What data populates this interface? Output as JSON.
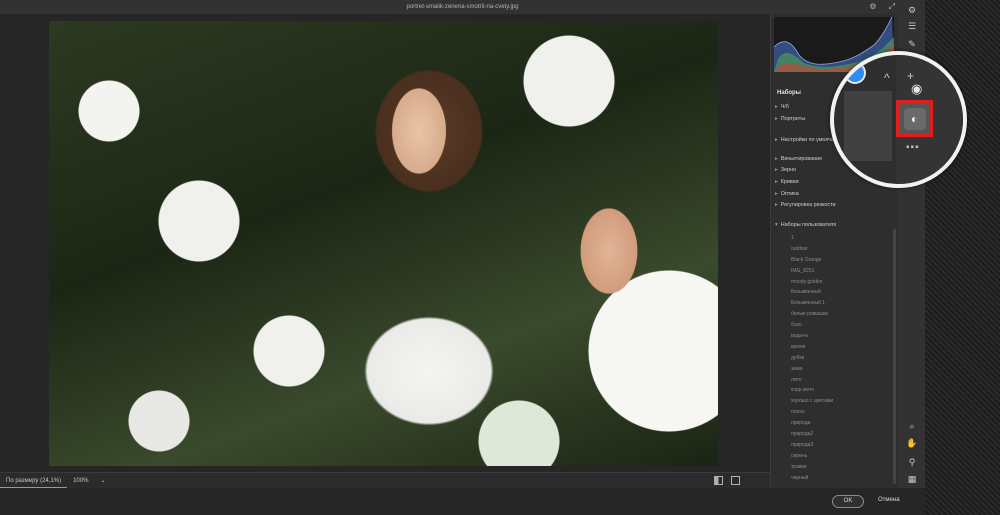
{
  "window": {
    "title": "portret-smaiik-zenena-smotrit-na-cvety.jpg"
  },
  "titlebar_icons": [
    "gear-icon",
    "expand-icon"
  ],
  "canvas": {
    "zoom_fit_label": "По размеру (24,1%)",
    "zoom_percent": "100%",
    "zoom_arrow": "⌄"
  },
  "panel": {
    "header": "Наборы",
    "sections": [
      {
        "label": "Ч/б",
        "open": false
      },
      {
        "label": "Портреты",
        "open": false
      },
      {
        "label": "Настройки по умолчан",
        "open": false
      },
      {
        "label": "Виньетирование",
        "open": false
      },
      {
        "label": "Зерно",
        "open": false
      },
      {
        "label": "Кривая",
        "open": false
      },
      {
        "label": "Оптика",
        "open": false
      },
      {
        "label": "Регулировка резкости",
        "open": false
      },
      {
        "label": "Наборы пользователя",
        "open": true
      }
    ],
    "user_presets": [
      "1",
      "outdoor",
      "Black Orange",
      "IMG_8251",
      "moody golden",
      "Безымянный",
      "Безымянный 1",
      "белые ромашки",
      "бохо",
      "вода+а",
      "время",
      "дубки",
      "зима",
      "лето",
      "корр.мето",
      "хорошо с цветами",
      "плохо",
      "природа",
      "природа2",
      "природа3",
      "сирень",
      "травки",
      "черный"
    ]
  },
  "buttons": {
    "ok": "OK",
    "cancel": "Отмена"
  },
  "magnifier": {
    "chevron": "^",
    "plus": "+",
    "eye": "◉",
    "preset": "◐",
    "dots": "▪▪▪"
  },
  "colors": {
    "accent_blue": "#2f8cf4",
    "highlight_red": "#e01e1e"
  }
}
